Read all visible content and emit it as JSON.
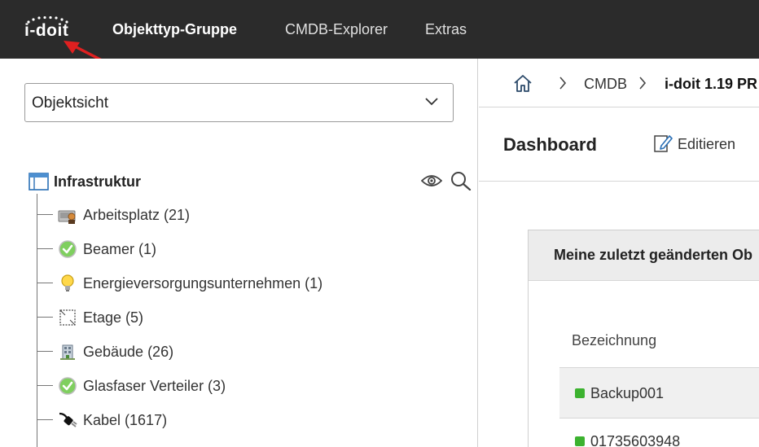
{
  "app": {
    "logo_text": "i-doit",
    "nav": [
      {
        "label": "Objekttyp-Gruppe",
        "active": true
      },
      {
        "label": "CMDB-Explorer",
        "active": false
      },
      {
        "label": "Extras",
        "active": false
      }
    ],
    "colors": {
      "topbar": "#2b2b2b",
      "arrow": "#e02020",
      "status_green": "#3cb22f"
    }
  },
  "sidebar": {
    "view_select": {
      "value": "Objektsicht"
    },
    "tree": {
      "root": {
        "label": "Infrastruktur",
        "icon": "window-icon"
      },
      "items": [
        {
          "label": "Arbeitsplatz (21)",
          "icon": "workplace-icon"
        },
        {
          "label": "Beamer (1)",
          "icon": "check-circle-icon"
        },
        {
          "label": "Energieversorgungsunternehmen (1)",
          "icon": "lightbulb-icon"
        },
        {
          "label": "Etage (5)",
          "icon": "floor-icon"
        },
        {
          "label": "Gebäude (26)",
          "icon": "building-icon"
        },
        {
          "label": "Glasfaser Verteiler (3)",
          "icon": "check-circle-icon"
        },
        {
          "label": "Kabel (1617)",
          "icon": "cable-icon"
        }
      ]
    }
  },
  "main": {
    "breadcrumb": [
      {
        "label": "CMDB"
      },
      {
        "label": "i-doit 1.19 PR"
      }
    ],
    "dashboard": {
      "title": "Dashboard",
      "edit_label": "Editieren"
    },
    "widget": {
      "title": "Meine zuletzt geänderten Ob",
      "column_header": "Bezeichnung",
      "rows": [
        {
          "name": "Backup001",
          "status": "green"
        },
        {
          "name": "01735603948",
          "status": "green"
        }
      ]
    }
  }
}
